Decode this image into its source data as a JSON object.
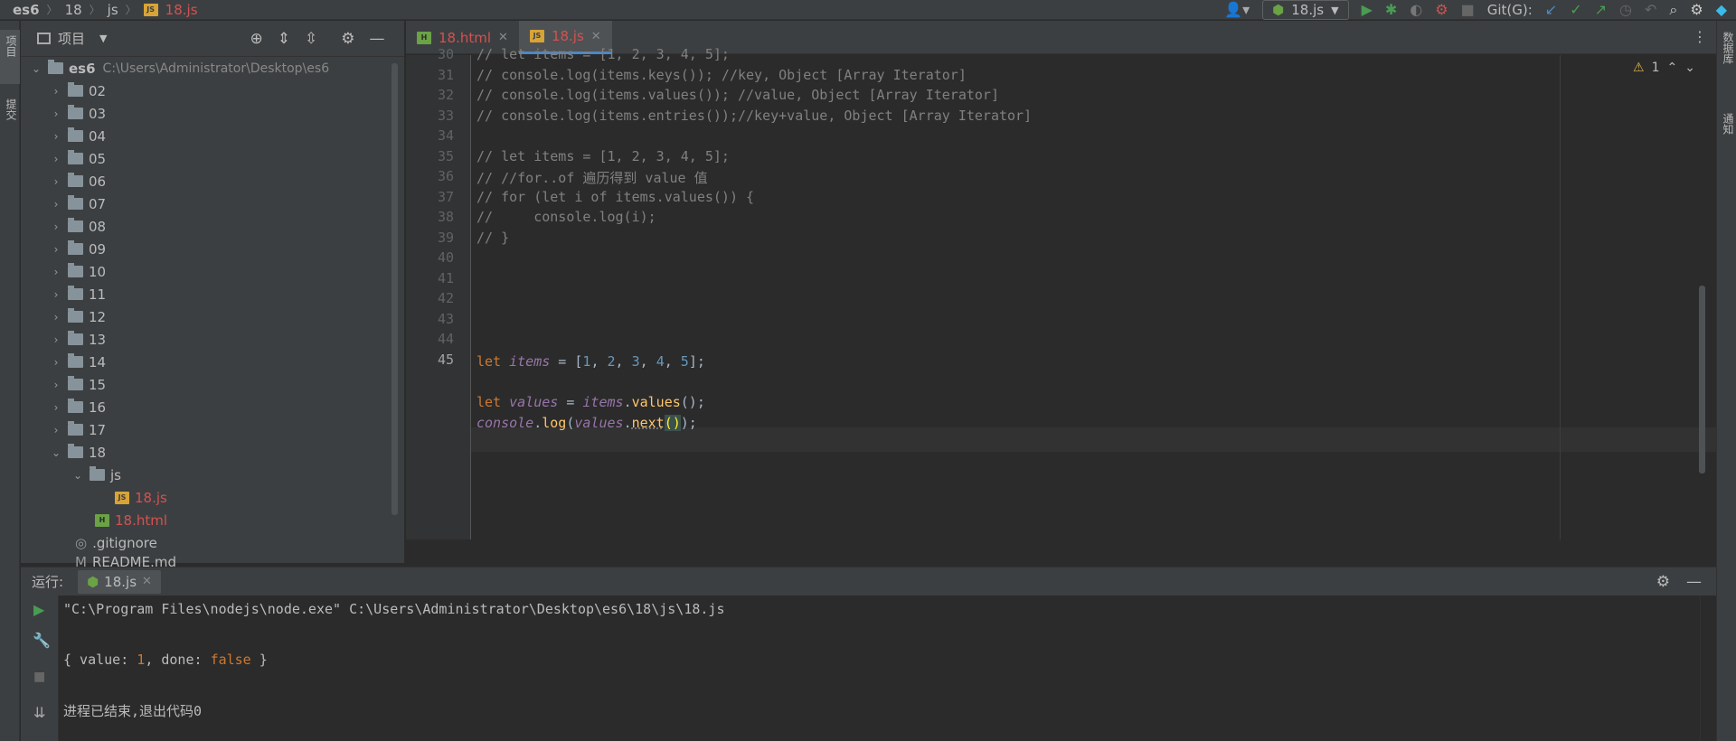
{
  "breadcrumb": {
    "items": [
      "es6",
      "18",
      "js"
    ],
    "file": "18.js"
  },
  "toolbar": {
    "run_config": "18.js",
    "git_label": "Git(G):"
  },
  "left_strip": {
    "project": "项目",
    "commit": "提交"
  },
  "right_strip": {
    "database": "数据库",
    "notifications": "通知"
  },
  "project": {
    "title": "项目",
    "root": {
      "name": "es6",
      "path": "C:\\Users\\Administrator\\Desktop\\es6"
    },
    "folders": [
      "02",
      "03",
      "04",
      "05",
      "06",
      "07",
      "08",
      "09",
      "10",
      "11",
      "12",
      "13",
      "14",
      "15",
      "16",
      "17",
      "18"
    ],
    "subfolder": "js",
    "files": {
      "js_file": "18.js",
      "html_file": "18.html",
      "gitignore": ".gitignore",
      "readme": "README.md"
    }
  },
  "editor": {
    "tabs": [
      {
        "label": "18.html",
        "icon": "html-file-icon"
      },
      {
        "label": "18.js",
        "icon": "js-file-icon",
        "active": true
      }
    ],
    "warning_count": "1",
    "line_numbers": [
      "30",
      "31",
      "32",
      "33",
      "34",
      "35",
      "36",
      "37",
      "38",
      "39",
      "40",
      "41",
      "42",
      "43",
      "44",
      "45"
    ],
    "comments": [
      "// let items = [1, 2, 3, 4, 5];",
      "// console.log(items.keys()); //key, Object [Array Iterator]",
      "// console.log(items.values()); //value, Object [Array Iterator]",
      "// console.log(items.entries());//key+value, Object [Array Iterator]",
      "// let items = [1, 2, 3, 4, 5];",
      "// //for..of 遍历得到 value 值",
      "// for (let i of items.values()) {",
      "//     console.log(i);",
      "// }"
    ],
    "code": {
      "l42": {
        "kw": "let",
        "name": "items",
        "eq": " = [",
        "n1": "1",
        "n2": "2",
        "n3": "3",
        "n4": "4",
        "n5": "5",
        "end": "];",
        "sep": ", "
      },
      "l44": {
        "kw": "let",
        "name": "values",
        "eq": " = ",
        "obj": "items",
        "dot": ".",
        "method": "values",
        "end": "();"
      },
      "l45": {
        "obj": "console",
        "dot": ".",
        "method": "log",
        "open": "(",
        "arg": "values",
        "dot2": ".",
        "method2": "next",
        "call": "()",
        "end": ");"
      }
    }
  },
  "run": {
    "label": "运行:",
    "tab": "18.js",
    "cmd": "\"C:\\Program Files\\nodejs\\node.exe\" C:\\Users\\Administrator\\Desktop\\es6\\18\\js\\18.js",
    "out_prefix": "{ value: ",
    "out_value": "1",
    "out_mid": ", done: ",
    "out_done": "false",
    "out_suffix": " }",
    "exit": "进程已结束,退出代码0"
  }
}
